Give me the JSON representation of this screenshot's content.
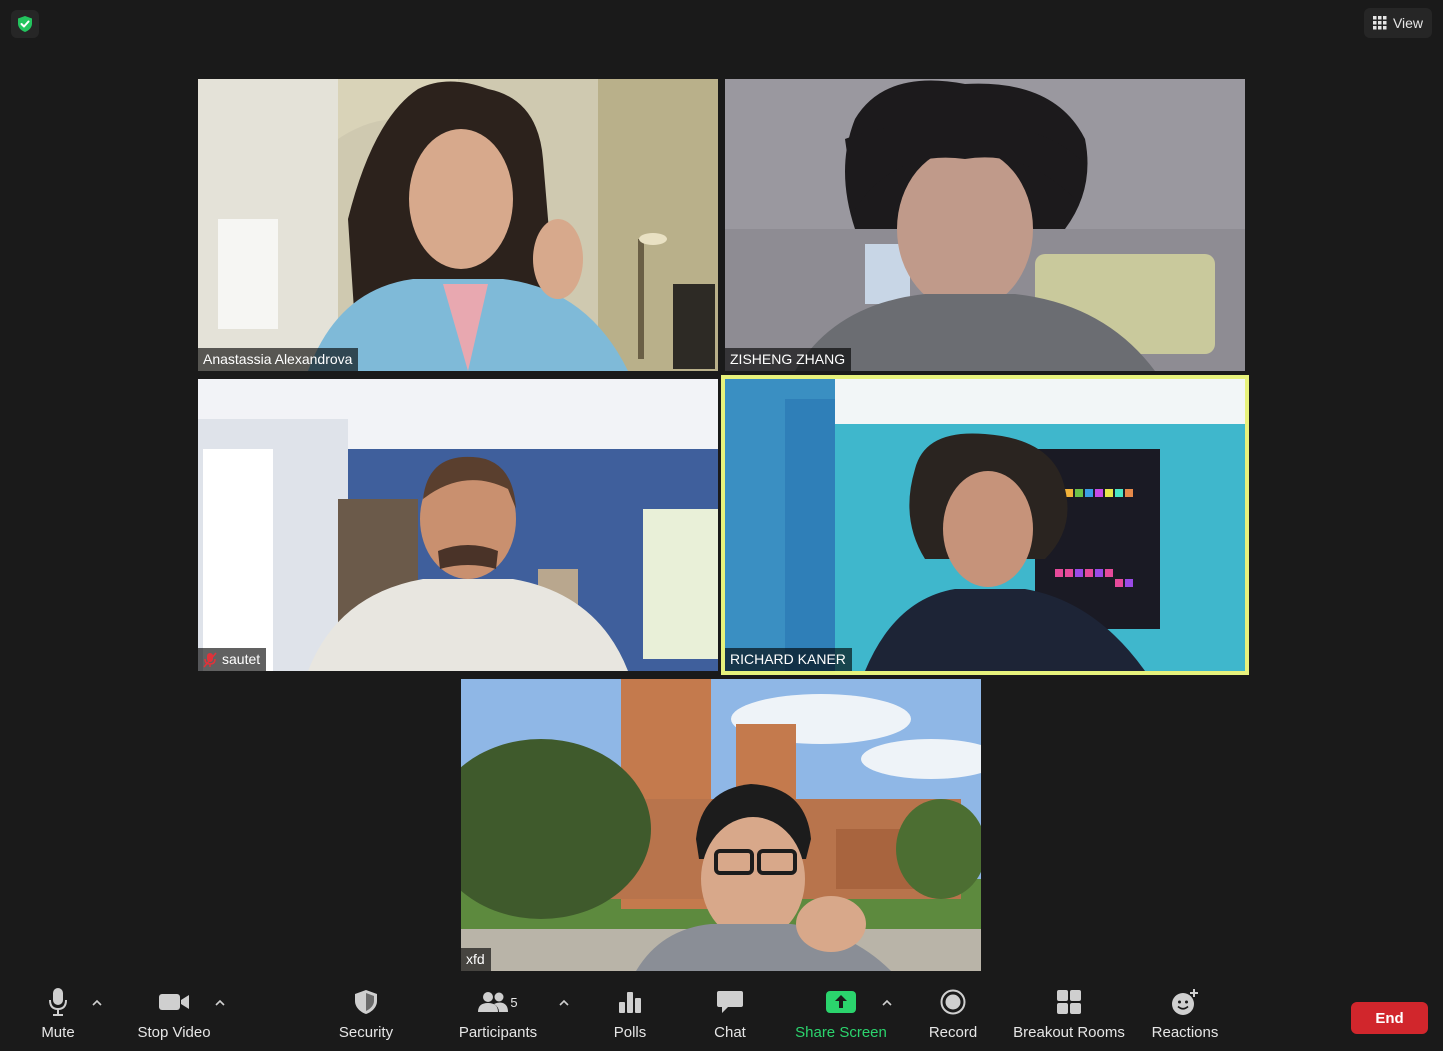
{
  "top": {
    "view_label": "View"
  },
  "participants_tiles": [
    {
      "name": "Anastassia Alexandrova",
      "muted": false
    },
    {
      "name": "ZISHENG ZHANG",
      "muted": false
    },
    {
      "name": "sautet",
      "muted": true
    },
    {
      "name": "RICHARD KANER",
      "muted": false,
      "active_speaker": true
    },
    {
      "name": "xfd",
      "muted": false
    }
  ],
  "toolbar": {
    "mute": "Mute",
    "stop_video": "Stop Video",
    "security": "Security",
    "participants": "Participants",
    "participants_count": "5",
    "polls": "Polls",
    "chat": "Chat",
    "share_screen": "Share Screen",
    "record": "Record",
    "breakout_rooms": "Breakout Rooms",
    "reactions": "Reactions",
    "end": "End"
  },
  "colors": {
    "background": "#1a1a1a",
    "active_speaker_border": "#e7f27c",
    "share_green": "#2bd46d",
    "end_red": "#d1262c",
    "secure_green": "#23c45e"
  },
  "icons": [
    "shield-check-icon",
    "grid-icon",
    "microphone-icon",
    "video-camera-icon",
    "security-shield-icon",
    "participants-icon",
    "polls-icon",
    "chat-icon",
    "share-screen-icon",
    "record-icon",
    "breakout-rooms-icon",
    "reactions-icon",
    "caret-up-icon",
    "mic-muted-icon"
  ]
}
